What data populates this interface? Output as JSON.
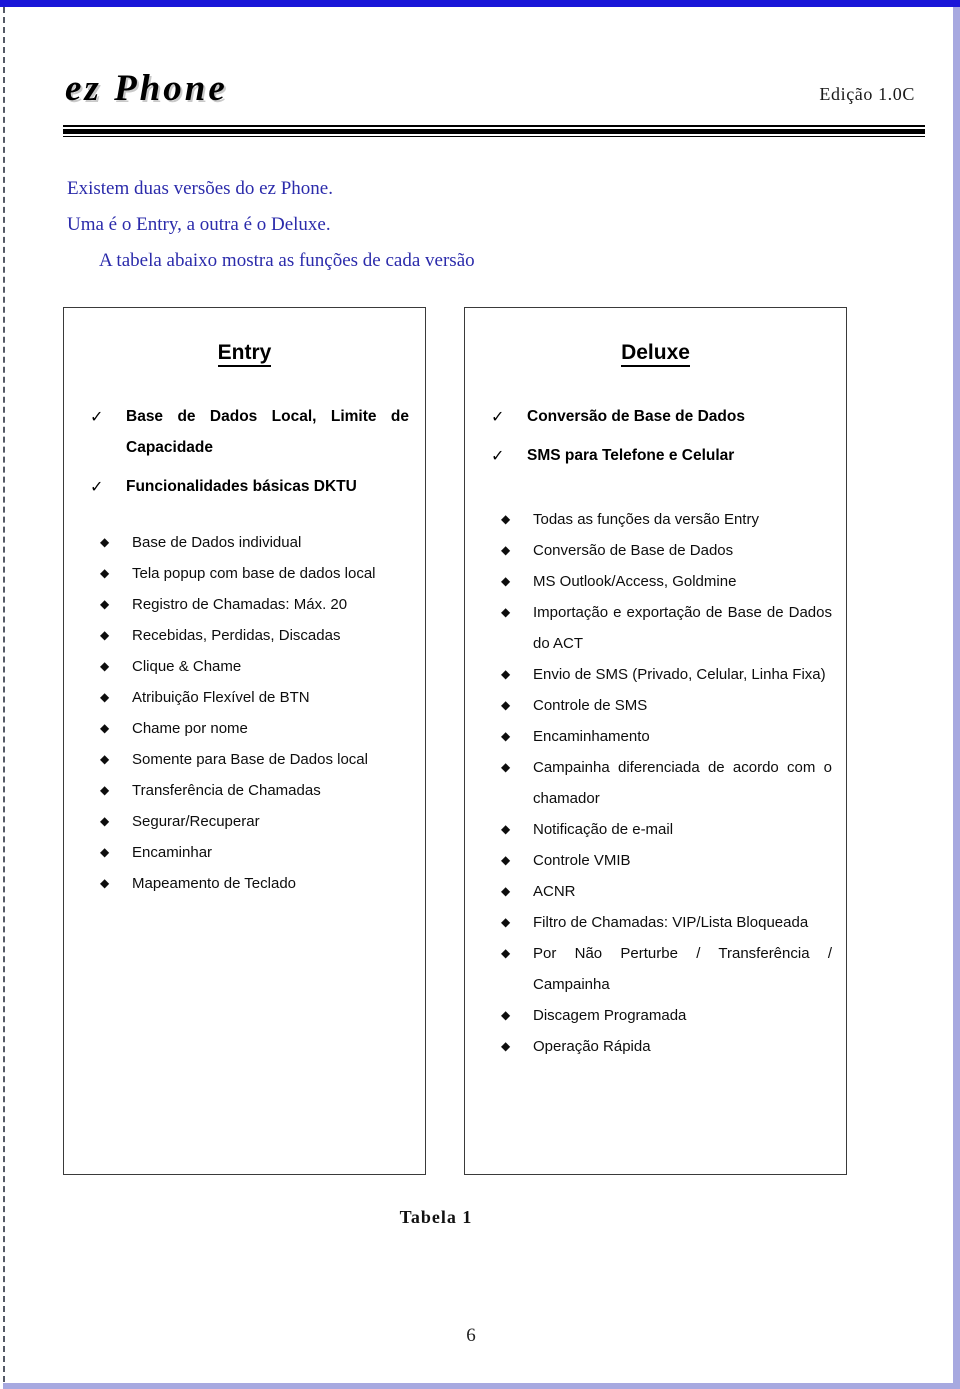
{
  "header": {
    "brand_title": "ez Phone",
    "edition": "Edição 1.0C"
  },
  "intro": {
    "line1": "Existem duas versões do ez Phone.",
    "line2": "Uma é o Entry, a outra é o Deluxe.",
    "line3": "A tabela abaixo mostra as funções de cada versão"
  },
  "table": {
    "entry": {
      "heading": "Entry",
      "check_items": [
        "Base de Dados Local, Limite de Capacidade",
        "Funcionalidades básicas DKTU"
      ],
      "diamond_items": [
        "Base de Dados individual",
        "Tela popup com base de dados local",
        "Registro de Chamadas: Máx. 20",
        "Recebidas, Perdidas, Discadas",
        "Clique & Chame",
        "Atribuição Flexível de BTN",
        "Chame por nome",
        "Somente para Base de Dados local",
        "Transferência de Chamadas",
        "Segurar/Recuperar",
        "Encaminhar",
        "Mapeamento de Teclado"
      ]
    },
    "deluxe": {
      "heading": "Deluxe",
      "check_items": [
        "Conversão de Base de Dados",
        "SMS para Telefone e Celular"
      ],
      "diamond_items": [
        "Todas as funções da versão Entry",
        "Conversão de Base de Dados",
        "MS Outlook/Access, Goldmine",
        "Importação e exportação de Base de Dados do ACT",
        "Envio de SMS (Privado, Celular, Linha Fixa)",
        "Controle de SMS",
        "Encaminhamento",
        "Campainha diferenciada de acordo com o chamador",
        "Notificação de e-mail",
        "Controle VMIB",
        "ACNR",
        "Filtro de Chamadas: VIP/Lista Bloqueada",
        "Por Não Perturbe / Transferência / Campainha",
        "Discagem Programada",
        "Operação Rápida"
      ]
    }
  },
  "caption": "Tabela 1",
  "page_number": "6",
  "colors": {
    "intro_text": "#2b2bab",
    "top_bar": "#1a16d8",
    "scroll_edge": "#a7a9e0",
    "box_border": "#3a3a3a"
  }
}
